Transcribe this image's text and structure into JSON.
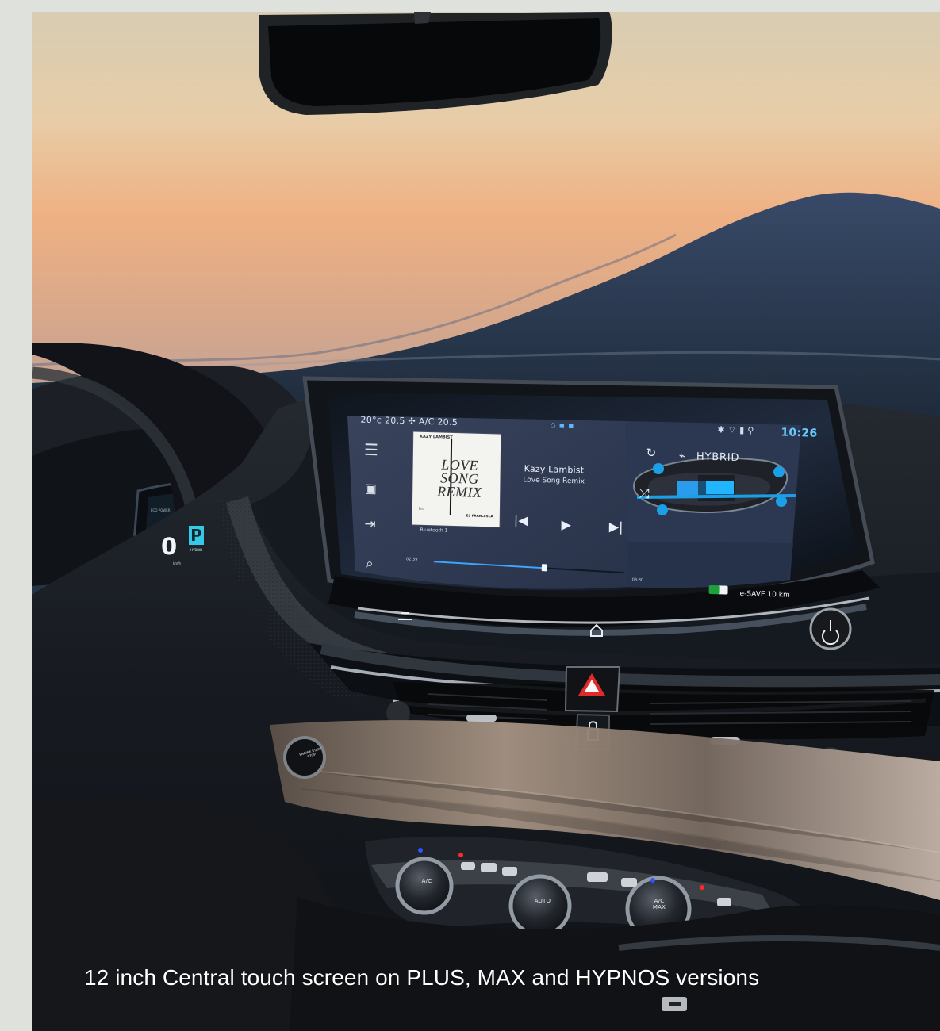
{
  "caption": "12 inch Central touch screen on PLUS, MAX and HYPNOS versions",
  "infotainment": {
    "status": {
      "climate": "20°c 20.5 ✣ A/C 20.5",
      "home_indicator": "⌂ ▪ ▪",
      "connectivity": "✱ ⌔ ▮ ⚲",
      "time": "10:26"
    },
    "media": {
      "artist": "Kazy Lambist",
      "track": "Love Song Remix",
      "album_art": {
        "artist": "KAZY LAMBIST",
        "title_line_1": "LOVE SONG",
        "title_line_2": "REMIX",
        "left_label": "bs",
        "footer": "ES FRANCESCA"
      },
      "source": "Bluetooth 1",
      "elapsed": "02:39",
      "duration": "03:30",
      "progress": 0.58
    },
    "hybrid_panel": {
      "title": "HYBRID",
      "ev_label": "e-SAVE 10 km"
    }
  },
  "cluster": {
    "labels": "ECO POWER",
    "speed": "0",
    "unit": "km/h",
    "gear": "P",
    "mode": "HYBRID"
  },
  "controls": {
    "ac_label": "A/C",
    "auto_label": "AUTO",
    "ac_max_label": "A/C MAX",
    "start_stop_label": "ENGINE START STOP"
  },
  "icons": {
    "menu": "☰",
    "media": "▣",
    "source": "⇥",
    "search": "⌕",
    "repeat": "↻",
    "shuffle": "⤮",
    "previous": "|◀",
    "play": "▶",
    "next": "▶|",
    "hybrid": "⌁"
  },
  "colors": {
    "screen_accent": "#3fa6ff",
    "gear_accent": "#33c9e7",
    "hazard_red": "#e02a2a",
    "hybrid_blue": "#1ea2ff",
    "ev_green": "#1fa03d"
  }
}
